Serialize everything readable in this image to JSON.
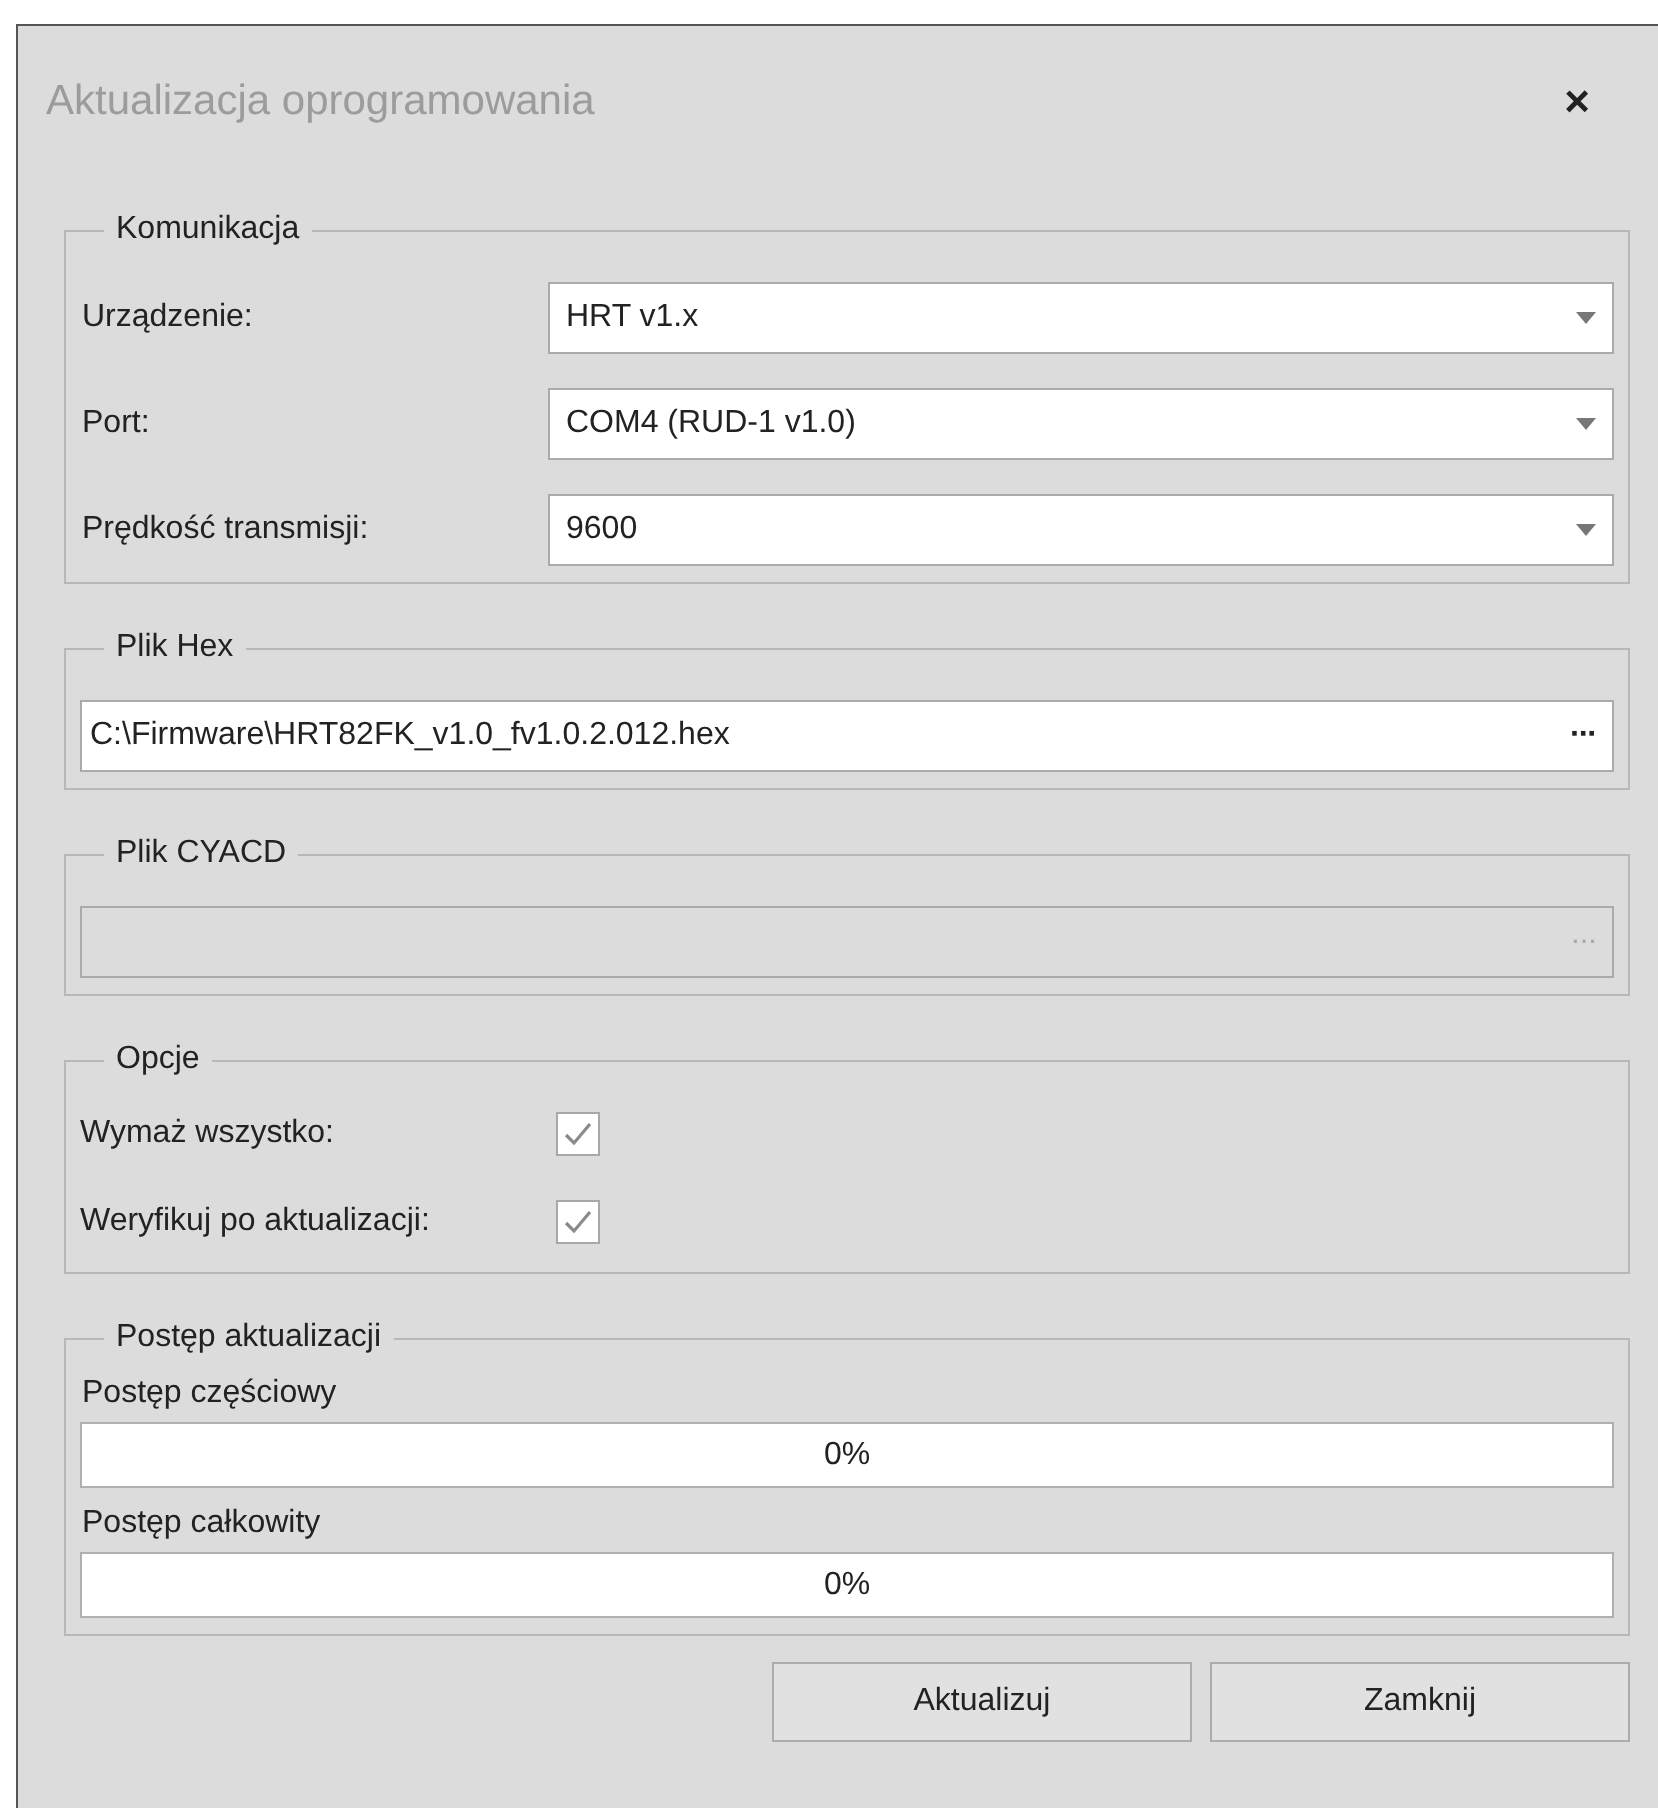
{
  "window": {
    "title": "Aktualizacja oprogramowania",
    "close": "×"
  },
  "communication": {
    "title": "Komunikacja",
    "fields": [
      {
        "label": "Urządzenie:",
        "value": "HRT v1.x"
      },
      {
        "label": "Port:",
        "value": "COM4 (RUD-1 v1.0)"
      },
      {
        "label": "Prędkość transmisji:",
        "value": "9600"
      }
    ]
  },
  "hex_file": {
    "title": "Plik Hex",
    "value": "C:\\Firmware\\HRT82FK_v1.0_fv1.0.2.012.hex",
    "browse": "···",
    "disabled": false
  },
  "cyacd_file": {
    "title": "Plik CYACD",
    "browse": "···",
    "disabled": true
  },
  "options": {
    "title": "Opcje",
    "items": [
      {
        "label": "Wymaż wszystko:",
        "checked": true
      },
      {
        "label": "Weryfikuj po aktualizacji:",
        "checked": true
      }
    ]
  },
  "progress": {
    "title": "Postęp aktualizacji",
    "bars": [
      {
        "label": "Postęp częściowy",
        "level": 0,
        "reading": "0%"
      },
      {
        "label": "Postęp całkowity",
        "level": 0,
        "reading": "0%"
      }
    ]
  },
  "buttons": [
    "Aktualizuj",
    "Zamknij"
  ]
}
